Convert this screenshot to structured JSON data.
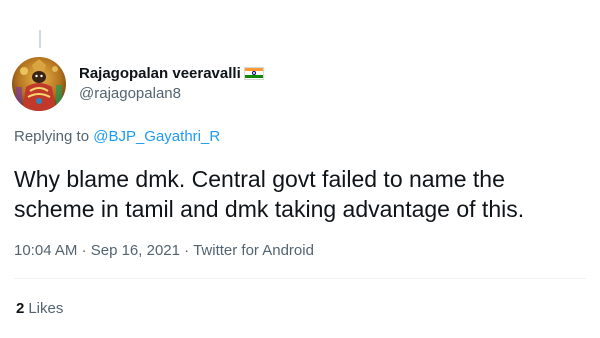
{
  "tweet": {
    "author": {
      "display_name": "Rajagopalan veeravalli",
      "flag_icon": "india-flag-icon",
      "handle": "@rajagopalan8"
    },
    "replying": {
      "prefix": "Replying to",
      "mention": "@BJP_Gayathri_R"
    },
    "text_line_1": "Why blame dmk. Central govt failed to name the",
    "text_line_2": "scheme in tamil and dmk taking advantage of this.",
    "time": "10:04 AM",
    "separator": "·",
    "date": "Sep 16, 2021",
    "source": "Twitter for Android",
    "likes": {
      "count": "2",
      "label": "Likes"
    }
  },
  "colors": {
    "primary_text": "#0f1419",
    "secondary_text": "#536471",
    "link": "#1d9bf0",
    "thread_line": "#cfd9de"
  }
}
